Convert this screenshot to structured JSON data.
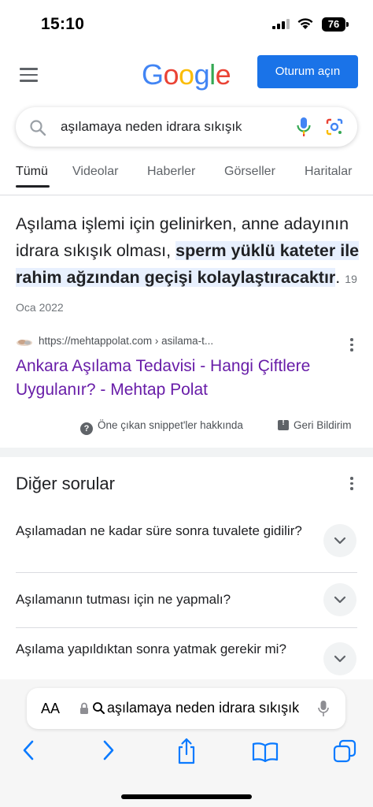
{
  "status_bar": {
    "time": "15:10",
    "battery": "76"
  },
  "header": {
    "logo_letters": [
      "G",
      "o",
      "o",
      "g",
      "l",
      "e"
    ],
    "signin_label": "Oturum açın",
    "search_query": "aşılamaya neden idrara sıkışık",
    "tabs": [
      "Tümü",
      "Videolar",
      "Haberler",
      "Görseller",
      "Haritalar"
    ],
    "active_tab": "Tümü"
  },
  "snippet": {
    "text_plain": "Aşılama işlemi için gelinirken, anne adayının idrara sıkışık olması, ",
    "text_highlight": "sperm yüklü kateter ile rahim ağzından geçişi kolaylaştıracaktır",
    "text_end": ".",
    "date": "19 Oca 2022",
    "source_url": "https://mehtappolat.com › asilama-t...",
    "result_title": "Ankara Aşılama Tedavisi - Hangi Çiftlere Uygulanır? - Mehtap Polat",
    "about_label": "Öne çıkan snippet'ler hakkında",
    "feedback_label": "Geri Bildirim"
  },
  "related_questions": {
    "title": "Diğer sorular",
    "items": [
      "Aşılamadan ne kadar süre sonra tuvalete gidilir?",
      "Aşılamanın tutması için ne yapmalı?",
      "Aşılama yapıldıktan sonra yatmak gerekir mi?"
    ]
  },
  "safari": {
    "text_size_label": "AA",
    "address_text": "aşılamaya neden idrara sıkışık"
  },
  "colors": {
    "google_blue": "#4285f4",
    "google_red": "#ea4335",
    "google_yellow": "#fbbc05",
    "google_green": "#34a853",
    "signin_button": "#1a73e8",
    "visited_link": "#681da8",
    "highlight_bg": "#e8f0fe",
    "safari_blue": "#0a7aff"
  },
  "icons": [
    "menu-icon",
    "search-icon",
    "microphone-icon",
    "google-lens-icon",
    "more-options-icon",
    "help-icon",
    "feedback-icon",
    "chevron-down-icon",
    "lock-icon",
    "back-icon",
    "forward-icon",
    "share-icon",
    "bookmarks-icon",
    "tabs-icon"
  ]
}
